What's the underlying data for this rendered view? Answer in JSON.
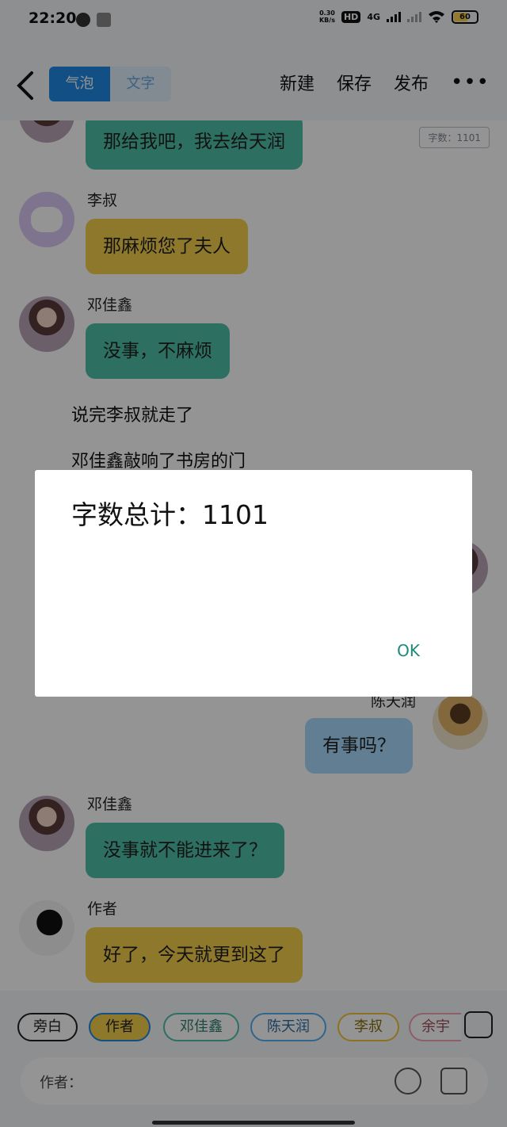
{
  "status_bar": {
    "time": "22:20",
    "net_speed_top": "0.30",
    "net_speed_bottom": "KB/s",
    "hd": "HD",
    "network": "4G",
    "battery": "60"
  },
  "header": {
    "tabs": [
      {
        "label": "气泡",
        "active": true
      },
      {
        "label": "文字",
        "active": false
      }
    ],
    "actions": {
      "new": "新建",
      "save": "保存",
      "publish": "发布",
      "more": "•••"
    }
  },
  "word_count_chip": "字数：1101",
  "messages": [
    {
      "speaker": "",
      "text": "那给我吧，我去给天润",
      "color": "#4fc1a8"
    },
    {
      "speaker": "李叔",
      "text": "那麻烦您了夫人",
      "color": "#f4cf4a"
    },
    {
      "speaker": "邓佳鑫",
      "text": "没事，不麻烦",
      "color": "#4fc1a8"
    },
    {
      "narration": "说完李叔就走了"
    },
    {
      "narration": "邓佳鑫敲响了书房的门"
    },
    {
      "speaker": "陈天润",
      "text": "有事吗？",
      "color": "#a9d9fb"
    },
    {
      "speaker": "邓佳鑫",
      "text": "没事就不能进来了？",
      "color": "#4fc1a8"
    },
    {
      "speaker": "作者",
      "text": "好了，今天就更到这了",
      "color": "#f4cf4a"
    }
  ],
  "roles": [
    "旁白",
    "作者",
    "邓佳鑫",
    "陈天润",
    "李叔",
    "余宇"
  ],
  "input": {
    "label": "作者："
  },
  "dialog": {
    "title": "字数总计：1101",
    "ok": "OK"
  }
}
